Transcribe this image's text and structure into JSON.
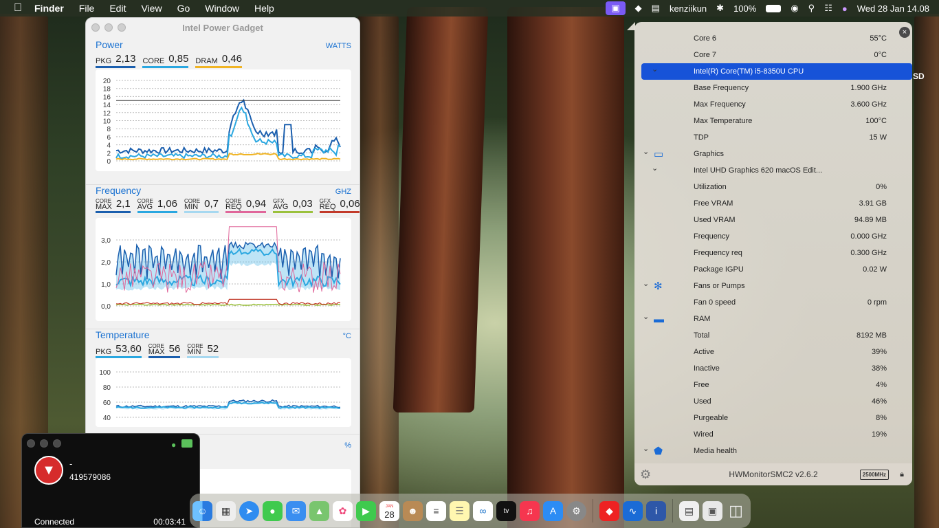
{
  "menubar": {
    "app": "Finder",
    "menus": [
      "File",
      "Edit",
      "View",
      "Go",
      "Window",
      "Help"
    ],
    "user": "kenziikun",
    "battery": "100%",
    "datetime": "Wed 28 Jan  14.08"
  },
  "ipg": {
    "title": "Intel Power Gadget",
    "power": {
      "heading": "Power",
      "unit": "WATTS",
      "legend": [
        {
          "key": "PKG",
          "value": "2,13",
          "color": "#1b5fae"
        },
        {
          "key": "CORE",
          "value": "0,85",
          "color": "#2aa7e0"
        },
        {
          "key": "DRAM",
          "value": "0,46",
          "color": "#f0b424"
        }
      ],
      "ticks": [
        "20",
        "18",
        "16",
        "14",
        "12",
        "10",
        "8",
        "6",
        "4",
        "2",
        "0"
      ]
    },
    "frequency": {
      "heading": "Frequency",
      "unit": "GHZ",
      "legend": [
        {
          "k1": "CORE",
          "k2": "MAX",
          "value": "2,1",
          "color": "#1b5fae"
        },
        {
          "k1": "CORE",
          "k2": "AVG",
          "value": "1,06",
          "color": "#2aa7e0"
        },
        {
          "k1": "CORE",
          "k2": "MIN",
          "value": "0,7",
          "color": "#a6d8f0"
        },
        {
          "k1": "CORE",
          "k2": "REQ",
          "value": "0,94",
          "color": "#e0669a"
        },
        {
          "k1": "GFX",
          "k2": "AVG",
          "value": "0,03",
          "color": "#9bc13c"
        },
        {
          "k1": "GFX",
          "k2": "REQ",
          "value": "0,06",
          "color": "#c23a2a"
        }
      ],
      "ticks": [
        "3,0",
        "2,0",
        "1,0",
        "0,0"
      ]
    },
    "temperature": {
      "heading": "Temperature",
      "unit": "°C",
      "legend": [
        {
          "k1": "",
          "k2": "PKG",
          "value": "53,60",
          "color": "#2aa7e0"
        },
        {
          "k1": "CORE",
          "k2": "MAX",
          "value": "56",
          "color": "#1b5fae"
        },
        {
          "k1": "CORE",
          "k2": "MIN",
          "value": "52",
          "color": "#a6d8f0"
        }
      ],
      "ticks": [
        "100",
        "80",
        "60",
        "40"
      ]
    },
    "util": {
      "unit": "%"
    }
  },
  "hw": {
    "rows": [
      {
        "label": "Core 6",
        "value": "55°C",
        "indent": 2
      },
      {
        "label": "Core 7",
        "value": "0°C",
        "indent": 2
      },
      {
        "label": "Intel(R) Core(TM) i5-8350U CPU",
        "value": "",
        "selected": true,
        "chev": true
      },
      {
        "label": "Base Frequency",
        "value": "1.900 GHz"
      },
      {
        "label": "Max Frequency",
        "value": "3.600 GHz"
      },
      {
        "label": "Max Temperature",
        "value": "100°C"
      },
      {
        "label": "TDP",
        "value": "15 W"
      },
      {
        "label": "Graphics",
        "value": "",
        "group": true,
        "icon": "display-icon"
      },
      {
        "label": "Intel UHD Graphics 620 macOS Edit...",
        "value": "",
        "chev": true
      },
      {
        "label": "Utilization",
        "value": "0%"
      },
      {
        "label": "Free VRAM",
        "value": "3.91 GB"
      },
      {
        "label": "Used VRAM",
        "value": "94.89 MB"
      },
      {
        "label": "Frequency",
        "value": "0.000 GHz"
      },
      {
        "label": "Frequency req",
        "value": "0.300 GHz"
      },
      {
        "label": "Package IGPU",
        "value": "0.02 W"
      },
      {
        "label": "Fans or Pumps",
        "value": "",
        "group": true,
        "icon": "fan-icon"
      },
      {
        "label": "Fan 0 speed",
        "value": "0 rpm"
      },
      {
        "label": "RAM",
        "value": "",
        "group": true,
        "icon": "ram-icon"
      },
      {
        "label": "Total",
        "value": "8192 MB"
      },
      {
        "label": "Active",
        "value": "39%"
      },
      {
        "label": "Inactive",
        "value": "38%"
      },
      {
        "label": "Free",
        "value": "4%"
      },
      {
        "label": "Used",
        "value": "46%"
      },
      {
        "label": "Purgeable",
        "value": "8%"
      },
      {
        "label": "Wired",
        "value": "19%"
      },
      {
        "label": "Media health",
        "value": "",
        "group": true,
        "icon": "shield-icon"
      }
    ],
    "footer": "HWMonitorSMC2 v2.6.2",
    "badge": "2500MHz",
    "side_label": "SD"
  },
  "call": {
    "name": "-",
    "number": "419579086",
    "status": "Connected",
    "timer": "00:03:41"
  },
  "dock": {
    "calendar_month": "JAN",
    "calendar_day": "28",
    "tv_label": "tv"
  }
}
